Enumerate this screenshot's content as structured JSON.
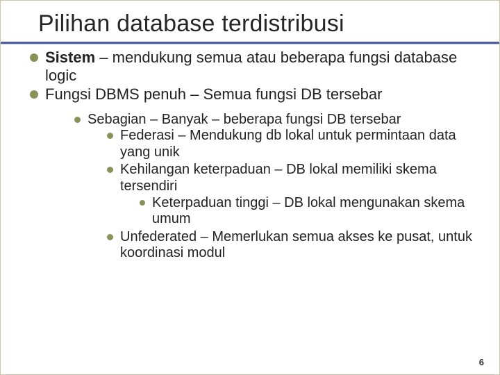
{
  "title": "Pilihan database terdistribusi",
  "bullets": {
    "b1_bold": "Sistem",
    "b1_rest": " – mendukung semua atau beberapa fungsi database logic",
    "b2": "Fungsi DBMS penuh – Semua fungsi DB tersebar",
    "s1": "Sebagian – Banyak – beberapa fungsi DB tersebar",
    "s1a": "Federasi – Mendukung db lokal untuk permintaan data yang unik",
    "s1b": "Kehilangan keterpaduan – DB lokal memiliki skema tersendiri",
    "s1b_i": "Keterpaduan tinggi – DB lokal mengunakan skema umum",
    "s1c": "Unfederated – Memerlukan semua akses ke pusat, untuk koordinasi modul"
  },
  "page_number": "6"
}
